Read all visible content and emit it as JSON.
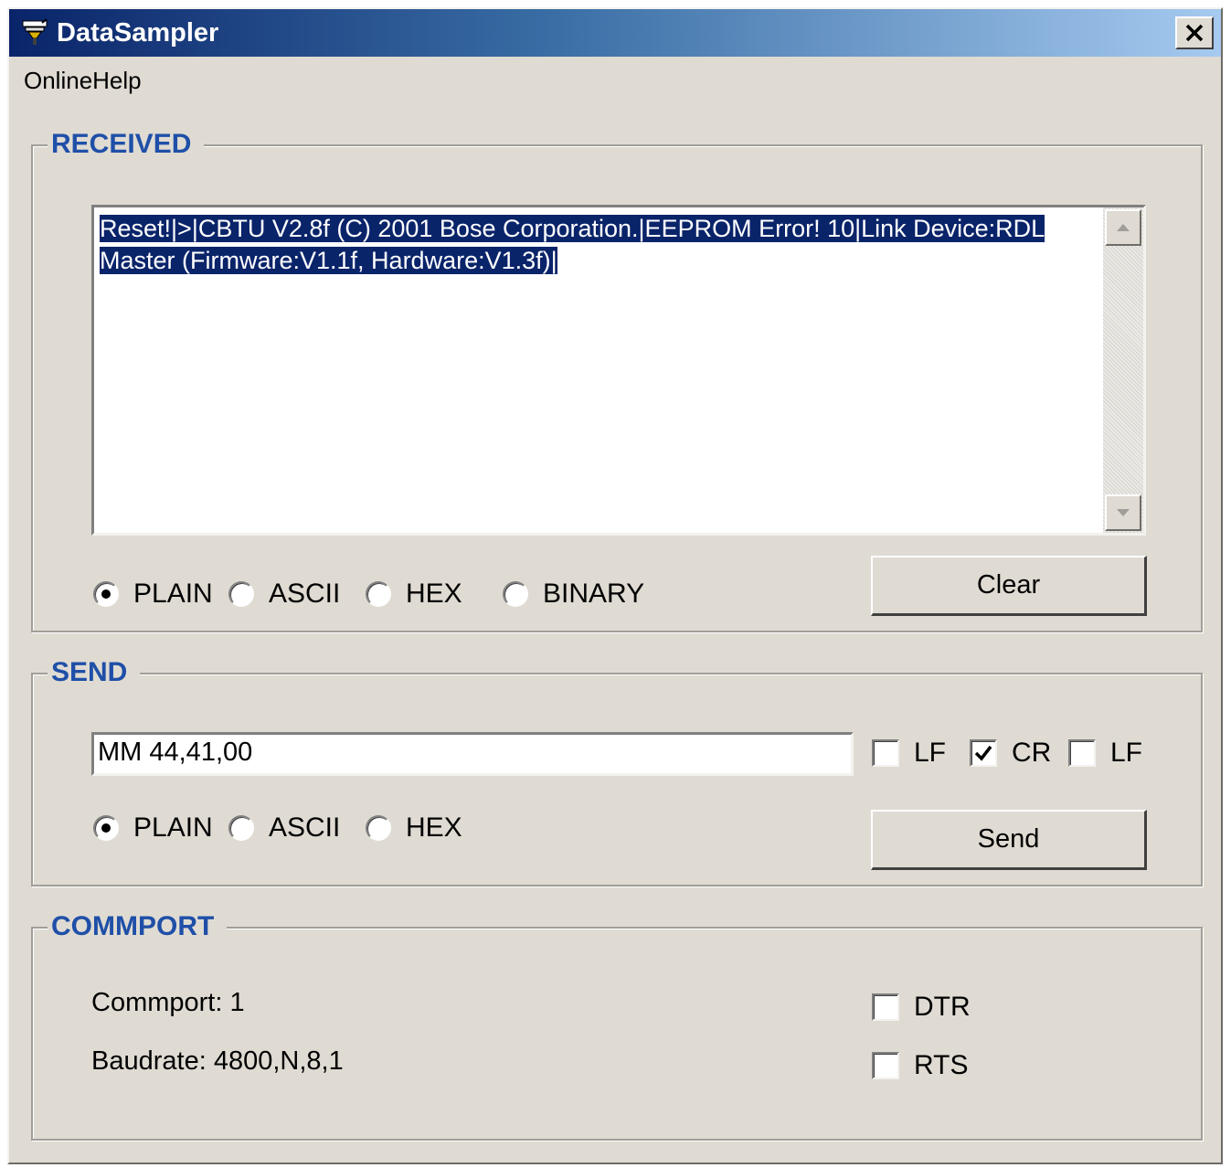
{
  "window": {
    "title": "DataSampler",
    "close_label": "✕"
  },
  "menu": {
    "items": [
      "OnlineHelp"
    ]
  },
  "received": {
    "group_label": "RECEIVED",
    "lines": [
      "Reset!|>|CBTU V2.8f (C) 2001 Bose Corporation.|EEPROM Error! 10|Link Device:RDL",
      "Master  (Firmware:V1.1f, Hardware:V1.3f)|"
    ],
    "format_options": [
      "PLAIN",
      "ASCII",
      "HEX",
      "BINARY"
    ],
    "selected_format": "PLAIN",
    "clear_label": "Clear"
  },
  "send": {
    "group_label": "SEND",
    "input_value": "MM 44,41,00",
    "checkboxes": [
      {
        "label": "LF",
        "checked": false
      },
      {
        "label": "CR",
        "checked": true
      },
      {
        "label": "LF",
        "checked": false
      }
    ],
    "format_options": [
      "PLAIN",
      "ASCII",
      "HEX"
    ],
    "selected_format": "PLAIN",
    "send_label": "Send"
  },
  "commport": {
    "group_label": "COMMPORT",
    "commport_text": "Commport: 1",
    "baudrate_text": "Baudrate: 4800,N,8,1",
    "checkboxes": [
      {
        "label": "DTR",
        "checked": false
      },
      {
        "label": "RTS",
        "checked": false
      }
    ]
  },
  "colors": {
    "title_gradient_start": "#0a246a",
    "title_gradient_end": "#a6caf0",
    "group_label": "#1f4fa8",
    "dialog_background": "#dfdbd3",
    "selection": "#0a246a"
  }
}
